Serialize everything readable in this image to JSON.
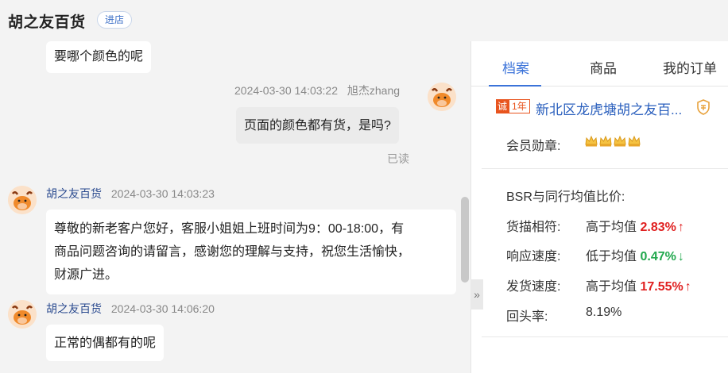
{
  "header": {
    "shop_name": "胡之友百货",
    "enter_label": "进店"
  },
  "messages": [
    {
      "text": "要哪个颜色的呢"
    },
    {
      "time": "2024-03-30 14:03:22",
      "sender": "旭杰zhang",
      "text": "页面的颜色都有货，是吗?",
      "status": "已读"
    },
    {
      "sender": "胡之友百货",
      "time": "2024-03-30 14:03:23",
      "lines": [
        "尊敬的新老客户您好，客服小姐姐上班时间为9：00-18:00，有",
        "商品问题咨询的请留言，感谢您的理解与支持，祝您生活愉快，",
        "财源广进。"
      ]
    },
    {
      "sender": "胡之友百货",
      "time": "2024-03-30 14:06:20",
      "text": "正常的偶都有的呢"
    }
  ],
  "collapse_icon": "»",
  "panel": {
    "tabs": [
      "档案",
      "商品",
      "我的订单"
    ],
    "badge_a": "诚",
    "badge_b": "1年",
    "store_name": "新北区龙虎塘胡之友百...",
    "medal_label": "会员勋章:",
    "bsr_title": "BSR与同行均值比价:",
    "metrics": [
      {
        "label": "货描相符:",
        "cmp": "高于均值",
        "value": "2.83%",
        "dir": "up",
        "arrow": "↑"
      },
      {
        "label": "响应速度:",
        "cmp": "低于均值",
        "value": "0.47%",
        "dir": "down",
        "arrow": "↓"
      },
      {
        "label": "发货速度:",
        "cmp": "高于均值",
        "value": "17.55%",
        "dir": "up",
        "arrow": "↑"
      }
    ],
    "return_label": "回头率:",
    "return_value": "8.19%"
  },
  "colors": {
    "accent": "#3b73d9",
    "up": "#e02020",
    "down": "#21a84d",
    "badge": "#e8541e"
  }
}
